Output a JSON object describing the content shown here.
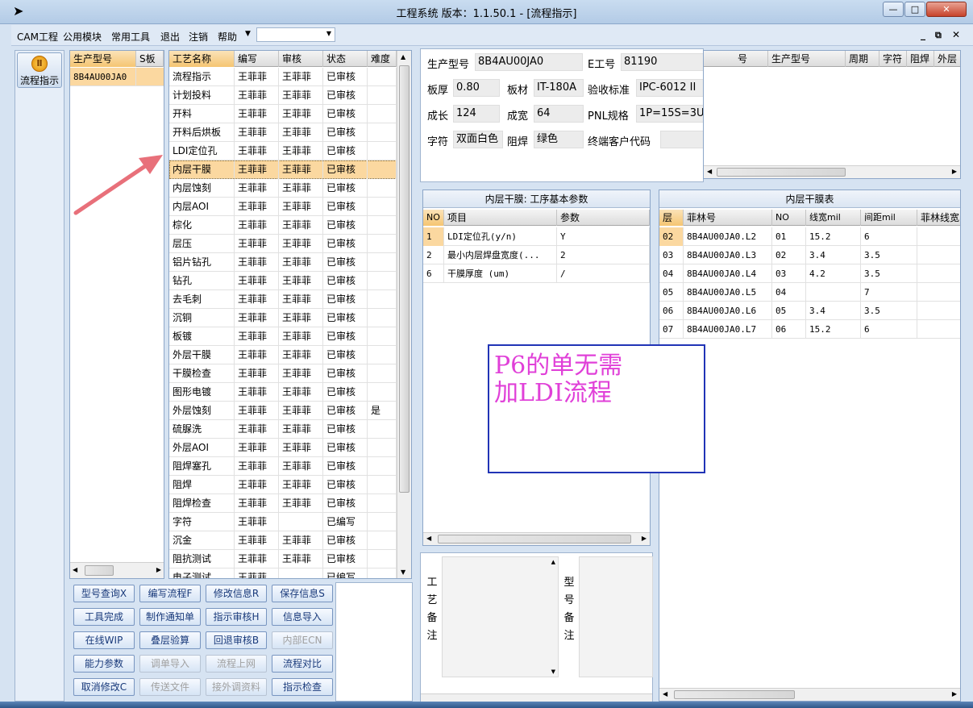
{
  "window": {
    "title": "工程系统   版本：1.1.50.1 - [流程指示]",
    "min": "—",
    "max": "□",
    "close": "✕"
  },
  "menu": {
    "items": [
      "CAM工程",
      "公用模块",
      "常用工具",
      "退出",
      "注销",
      "帮助"
    ],
    "combo_value": ""
  },
  "mdi_controls": [
    "_",
    "⧉",
    "✕"
  ],
  "left_nav": {
    "flow_label": "流程指示"
  },
  "model_list": {
    "headers": [
      "生产型号",
      "S板"
    ],
    "rows": [
      [
        "8B4AU00JA0",
        ""
      ]
    ]
  },
  "process": {
    "headers": [
      "工艺名称",
      "编写",
      "审核",
      "状态",
      "难度"
    ],
    "rows": [
      [
        "流程指示",
        "王菲菲",
        "王菲菲",
        "已审核",
        ""
      ],
      [
        "计划投料",
        "王菲菲",
        "王菲菲",
        "已审核",
        ""
      ],
      [
        "开料",
        "王菲菲",
        "王菲菲",
        "已审核",
        ""
      ],
      [
        "开料后烘板",
        "王菲菲",
        "王菲菲",
        "已审核",
        ""
      ],
      [
        "LDI定位孔",
        "王菲菲",
        "王菲菲",
        "已审核",
        ""
      ],
      [
        "内层干膜",
        "王菲菲",
        "王菲菲",
        "已审核",
        ""
      ],
      [
        "内层蚀刻",
        "王菲菲",
        "王菲菲",
        "已审核",
        ""
      ],
      [
        "内层AOI",
        "王菲菲",
        "王菲菲",
        "已审核",
        ""
      ],
      [
        "棕化",
        "王菲菲",
        "王菲菲",
        "已审核",
        ""
      ],
      [
        "层压",
        "王菲菲",
        "王菲菲",
        "已审核",
        ""
      ],
      [
        "铝片钻孔",
        "王菲菲",
        "王菲菲",
        "已审核",
        ""
      ],
      [
        "钻孔",
        "王菲菲",
        "王菲菲",
        "已审核",
        ""
      ],
      [
        "去毛刺",
        "王菲菲",
        "王菲菲",
        "已审核",
        ""
      ],
      [
        "沉铜",
        "王菲菲",
        "王菲菲",
        "已审核",
        ""
      ],
      [
        "板镀",
        "王菲菲",
        "王菲菲",
        "已审核",
        ""
      ],
      [
        "外层干膜",
        "王菲菲",
        "王菲菲",
        "已审核",
        ""
      ],
      [
        "干膜检查",
        "王菲菲",
        "王菲菲",
        "已审核",
        ""
      ],
      [
        "图形电镀",
        "王菲菲",
        "王菲菲",
        "已审核",
        ""
      ],
      [
        "外层蚀刻",
        "王菲菲",
        "王菲菲",
        "已审核",
        "是"
      ],
      [
        "硫脲洗",
        "王菲菲",
        "王菲菲",
        "已审核",
        ""
      ],
      [
        "外层AOI",
        "王菲菲",
        "王菲菲",
        "已审核",
        ""
      ],
      [
        "阻焊塞孔",
        "王菲菲",
        "王菲菲",
        "已审核",
        ""
      ],
      [
        "阻焊",
        "王菲菲",
        "王菲菲",
        "已审核",
        ""
      ],
      [
        "阻焊检查",
        "王菲菲",
        "王菲菲",
        "已审核",
        ""
      ],
      [
        "字符",
        "王菲菲",
        "",
        "已编写",
        ""
      ],
      [
        "沉金",
        "王菲菲",
        "王菲菲",
        "已审核",
        ""
      ],
      [
        "阻抗测试",
        "王菲菲",
        "王菲菲",
        "已审核",
        ""
      ],
      [
        "电子测试",
        "王菲菲",
        "",
        "已编写",
        ""
      ]
    ],
    "selected_index": 5
  },
  "buttons": [
    [
      "型号查询X",
      "编写流程F",
      "修改信息R",
      "保存信息S"
    ],
    [
      "工具完成",
      "制作通知单",
      "指示审核H",
      "信息导入"
    ],
    [
      "在线WIP",
      "叠层验算",
      "回退审核B",
      "内部ECN"
    ],
    [
      "能力参数",
      "调单导入",
      "流程上网",
      "流程对比"
    ],
    [
      "取消修改C",
      "传送文件",
      "接外调资料",
      "指示检查"
    ]
  ],
  "disabled_buttons": [
    "内部ECN",
    "调单导入",
    "流程上网",
    "传送文件",
    "接外调资料"
  ],
  "info": {
    "fields": [
      {
        "label": "生产型号",
        "value": "8B4AU00JA0"
      },
      {
        "label": "E工号",
        "value": "81190"
      },
      {
        "label": "板厚",
        "value": "0.80"
      },
      {
        "label": "板材",
        "value": "IT-180A"
      },
      {
        "label": "验收标准",
        "value": "IPC-6012 II"
      },
      {
        "label": "成长",
        "value": "124"
      },
      {
        "label": "成宽",
        "value": "64"
      },
      {
        "label": "PNL规格",
        "value": "1P=15S=3U"
      },
      {
        "label": "字符",
        "value": "双面白色"
      },
      {
        "label": "阻焊",
        "value": "绿色"
      },
      {
        "label": "终端客户代码",
        "value": ""
      }
    ]
  },
  "right_top_grid": {
    "headers": [
      "号",
      "生产型号",
      "周期",
      "字符",
      "阻焊",
      "外层"
    ]
  },
  "params": {
    "title": "内层干膜: 工序基本参数",
    "headers": [
      "NO",
      "项目",
      "参数"
    ],
    "rows": [
      [
        "1",
        "LDI定位孔(y/n)",
        "Y"
      ],
      [
        "2",
        "最小内层焊盘宽度(...",
        "2"
      ],
      [
        "6",
        "干膜厚度 (um)",
        "/"
      ]
    ]
  },
  "film_table": {
    "title": "内层干膜表",
    "headers": [
      "层",
      "菲林号",
      "NO",
      "线宽mil",
      "间距mil",
      "菲林线宽"
    ],
    "rows": [
      [
        "02",
        "8B4AU00JA0.L2",
        "01",
        "15.2",
        "6",
        ""
      ],
      [
        "03",
        "8B4AU00JA0.L3",
        "02",
        "3.4",
        "3.5",
        ""
      ],
      [
        "04",
        "8B4AU00JA0.L4",
        "03",
        "4.2",
        "3.5",
        ""
      ],
      [
        "05",
        "8B4AU00JA0.L5",
        "04",
        "",
        "7",
        ""
      ],
      [
        "06",
        "8B4AU00JA0.L6",
        "05",
        "3.4",
        "3.5",
        ""
      ],
      [
        "07",
        "8B4AU00JA0.L7",
        "06",
        "15.2",
        "6",
        ""
      ]
    ]
  },
  "remarks": {
    "process_label": "工艺备注",
    "model_label": "型号备注"
  },
  "annotation": {
    "text_line1": "P6的单无需",
    "text_line2": "加LDI流程",
    "arrow_color": "#e8707a",
    "text_color": "#e040d8",
    "border_color": "#2134b6"
  }
}
